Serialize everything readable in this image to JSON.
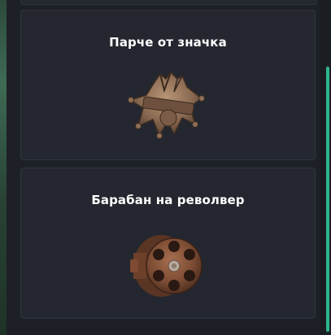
{
  "items": [
    {
      "title": "Парче от значка",
      "icon": "sheriff-badge-fragment-icon"
    },
    {
      "title": "Барабан на револвер",
      "icon": "revolver-cylinder-icon"
    }
  ],
  "colors": {
    "background": "#1d2026",
    "card": "#24272f",
    "card_border": "#30343d",
    "title": "#ffffff",
    "scrollbar": "#2fb58e"
  }
}
